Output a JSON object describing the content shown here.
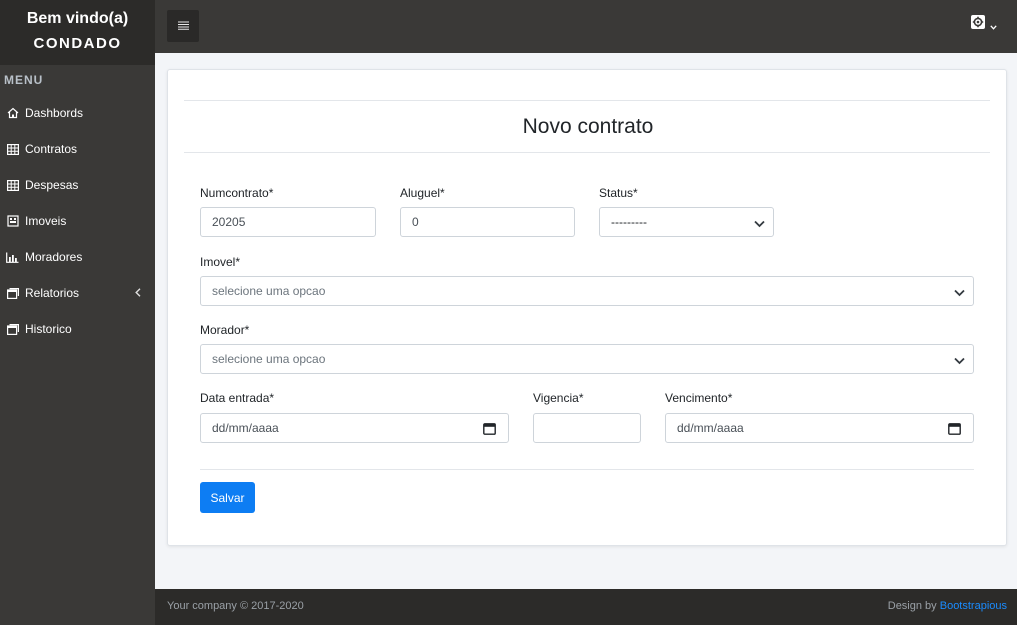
{
  "sidebar": {
    "welcome": "Bem vindo(a)",
    "company": "CONDADO",
    "menu_title": "MENU",
    "items": [
      {
        "label": "Dashbords",
        "icon": "home-icon"
      },
      {
        "label": "Contratos",
        "icon": "table-icon"
      },
      {
        "label": "Despesas",
        "icon": "table-icon"
      },
      {
        "label": "Imoveis",
        "icon": "building-icon"
      },
      {
        "label": "Moradores",
        "icon": "bar-chart-icon"
      },
      {
        "label": "Relatorios",
        "icon": "window-icon"
      },
      {
        "label": "Historico",
        "icon": "window-icon"
      }
    ]
  },
  "topbar": {
    "toggle_icon": "menu-icon",
    "settings_icon": "gear-icon"
  },
  "form": {
    "title": "Novo contrato",
    "numcontrato": {
      "label": "Numcontrato*",
      "value": "20205"
    },
    "aluguel": {
      "label": "Aluguel*",
      "value": "0"
    },
    "status": {
      "label": "Status*",
      "value": "---------"
    },
    "imovel": {
      "label": "Imovel*",
      "placeholder": "selecione uma opcao"
    },
    "morador": {
      "label": "Morador*",
      "placeholder": "selecione uma opcao"
    },
    "data_entrada": {
      "label": "Data entrada*",
      "placeholder": "dd/mm/aaaa"
    },
    "vigencia": {
      "label": "Vigencia*",
      "value": ""
    },
    "vencimento": {
      "label": "Vencimento*",
      "placeholder": "dd/mm/aaaa"
    },
    "save_label": "Salvar"
  },
  "footer": {
    "copyright": "Your company © 2017-2020",
    "design_prefix": "Design by ",
    "design_link": "Bootstrapious"
  },
  "colors": {
    "sidebar_bg": "#3a3937",
    "brand_bg": "#2c2b29",
    "primary": "#0d7df3",
    "link": "#1a8cff"
  }
}
